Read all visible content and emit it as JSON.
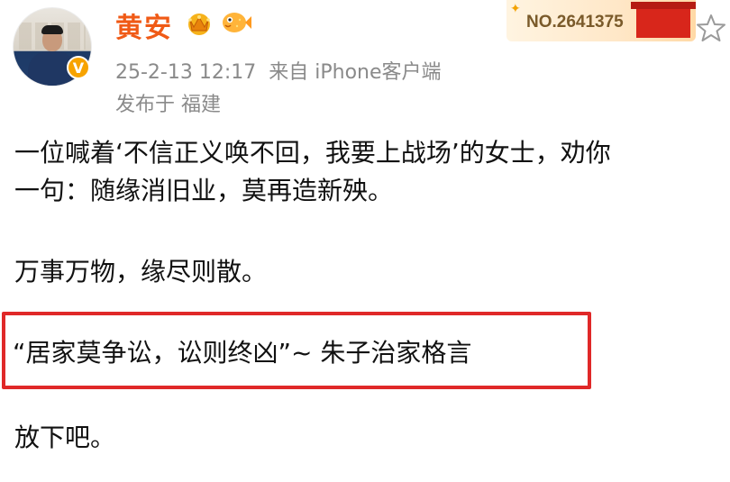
{
  "post": {
    "author": {
      "name": "黄安",
      "verified_mark": "V",
      "icons": [
        "crown-icon",
        "puffer-fish-icon"
      ]
    },
    "meta": {
      "time": "25-2-13 12:17",
      "source": "来自 iPhone客户端",
      "location": "发布于 福建"
    },
    "fan_badge": {
      "number": "NO.2641375"
    },
    "body": {
      "line1": "一位喊着‘不信正义唤不回，我要上战场’的女士，劝你",
      "line2": "一句：随缘消旧业，莫再造新殃。",
      "line3": "万事万物，缘尽则散。",
      "quote": "“居家莫争讼，讼则终凶”~ 朱子治家格言",
      "line5": "放下吧。"
    }
  },
  "colors": {
    "username": "#f05a16",
    "meta": "#8a8a8a",
    "highlight_border": "#e02828",
    "verified": "#f7a300"
  }
}
